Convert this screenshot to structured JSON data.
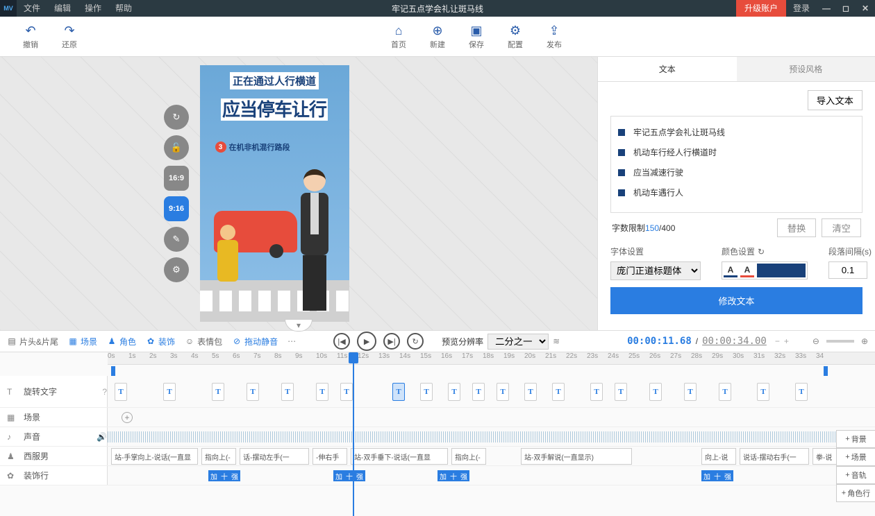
{
  "titlebar": {
    "logo": "MV",
    "menus": [
      "文件",
      "编辑",
      "操作",
      "帮助"
    ],
    "title": "牢记五点学会礼让斑马线",
    "upgrade": "升级账户",
    "login": "登录"
  },
  "toolbar": {
    "undo": "撤销",
    "redo": "还原",
    "home": "首页",
    "new": "新建",
    "save": "保存",
    "config": "配置",
    "publish": "发布"
  },
  "canvas": {
    "line1": "正在通过人行横道",
    "line2": "应当停车让行",
    "badge_num": "3",
    "badge_label": "在机非机混行路段",
    "tools": {
      "refresh": "↻",
      "lock": "🔓",
      "r169": "16:9",
      "r916": "9:16",
      "edit": "✎",
      "gear": "⚙"
    }
  },
  "right": {
    "tab1": "文本",
    "tab2": "预设风格",
    "import": "导入文本",
    "items": [
      "牢记五点学会礼让斑马线",
      "机动车行经人行横道时",
      "应当减速行驶",
      "机动车遇行人"
    ],
    "limit_label": "字数限制",
    "limit_cur": "150",
    "limit_max": "/400",
    "replace": "替换",
    "clear": "清空",
    "font_label": "字体设置",
    "font_value": "庞门正道标题体",
    "color_label": "颜色设置",
    "spacing_label": "段落间隔(s)",
    "spacing_value": "0.1",
    "modify": "修改文本"
  },
  "tlbar": {
    "opts": [
      "片头&片尾",
      "场景",
      "角色",
      "装饰",
      "表情包",
      "拖动静音"
    ],
    "preview_label": "预览分辨率",
    "preview_value": "二分之一",
    "time_cur": "00:00:11.68",
    "time_sep": "/",
    "time_tot": "00:00:34.00"
  },
  "tracks": {
    "rotate": "旋转文字",
    "scene": "场景",
    "sound": "声音",
    "man": "西服男",
    "deco": "装饰行"
  },
  "side_btns": [
    "背景",
    "场景",
    "音轨",
    "角色行"
  ],
  "ruler_ticks": [
    "0s",
    "1s",
    "2s",
    "3s",
    "4s",
    "5s",
    "6s",
    "7s",
    "8s",
    "9s",
    "10s",
    "11s",
    "12s",
    "13s",
    "14s",
    "15s",
    "16s",
    "17s",
    "18s",
    "19s",
    "20s",
    "21s",
    "22s",
    "23s",
    "24s",
    "25s",
    "26s",
    "27s",
    "28s",
    "29s",
    "30s",
    "31s",
    "32s",
    "33s",
    "34"
  ],
  "segments": [
    "站-手掌向上-说话(一直显",
    "指向上(-",
    "话-摆动左手(一",
    "-伸右手",
    "站-双手垂下-说话(一直显",
    "指向上(-",
    "站-双手解说(一直显示)",
    "向上-说",
    "说话-摆动右手(一",
    "拳-说"
  ],
  "blue_labels": [
    "加",
    "十",
    "强",
    "加",
    "十",
    "强",
    "加",
    "十",
    "强",
    "加",
    "十",
    "强"
  ]
}
